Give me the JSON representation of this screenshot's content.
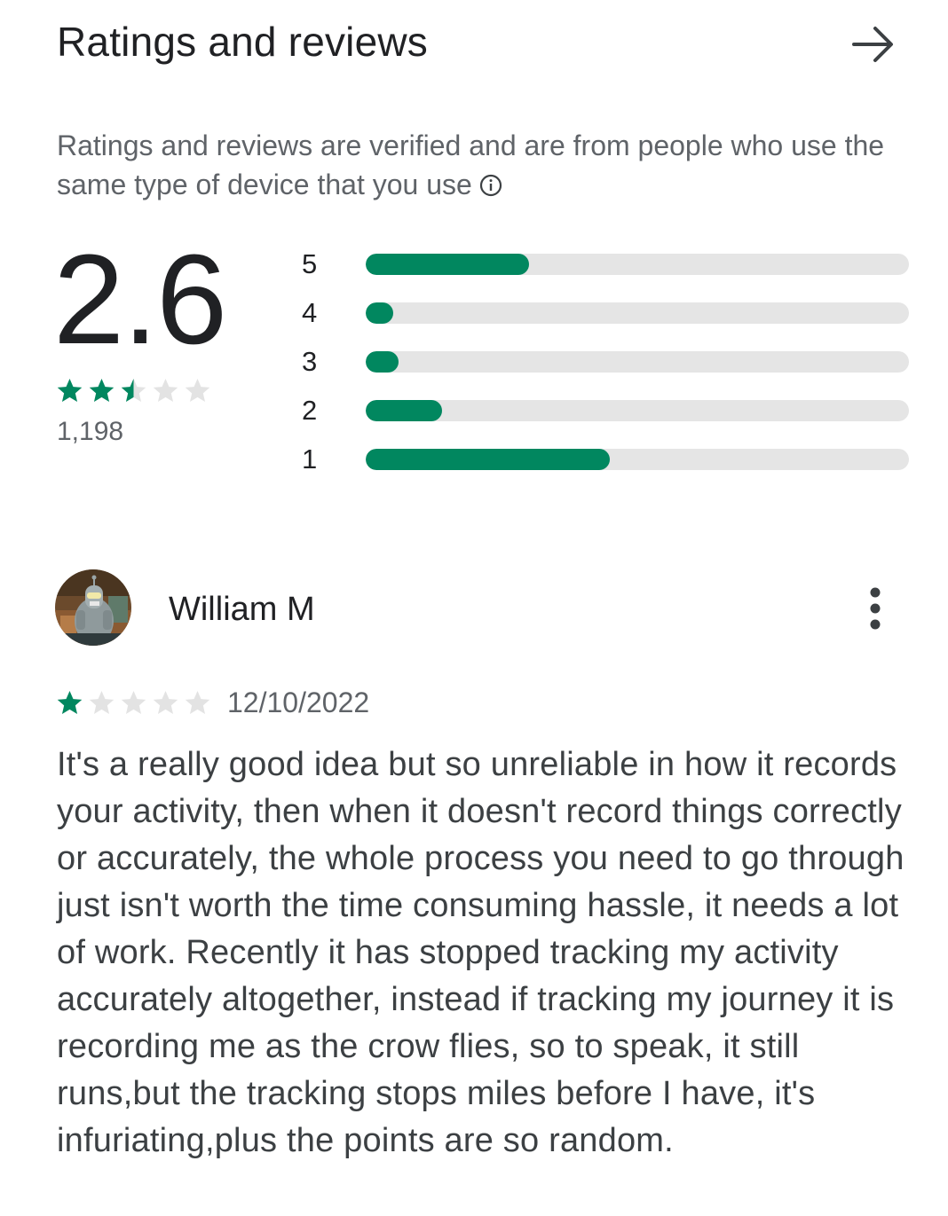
{
  "header": {
    "title": "Ratings and reviews",
    "arrow_icon": "arrow-right-icon"
  },
  "disclaimer": {
    "text": "Ratings and reviews are verified and are from people who use the same type of device that you use",
    "info_icon": "info-icon"
  },
  "summary": {
    "score": "2.6",
    "star_rating": 2.5,
    "count": "1,198"
  },
  "histogram": [
    {
      "label": "5",
      "fraction": 0.3
    },
    {
      "label": "4",
      "fraction": 0.05
    },
    {
      "label": "3",
      "fraction": 0.06
    },
    {
      "label": "2",
      "fraction": 0.14
    },
    {
      "label": "1",
      "fraction": 0.45
    }
  ],
  "review": {
    "author": "William M",
    "avatar_icon": "robot-avatar",
    "more_icon": "more-vert-icon",
    "stars": 1,
    "date": "12/10/2022",
    "text": "It's a really good idea but so unreliable in how it records your activity, then when it doesn't record things correctly or accurately, the whole process you need to go through just isn't worth the time consuming hassle, it needs a lot of work. Recently it has stopped tracking my activity accurately altogether, instead if tracking my journey it is recording me as the crow flies, so to speak, it still runs,but the tracking stops miles before I have, it's infuriating,plus the points are so random."
  },
  "colors": {
    "accent": "#01875f",
    "track": "#e5e5e5",
    "empty_star": "#e3e3e3",
    "text_primary": "#202124",
    "text_secondary": "#5f6368"
  }
}
